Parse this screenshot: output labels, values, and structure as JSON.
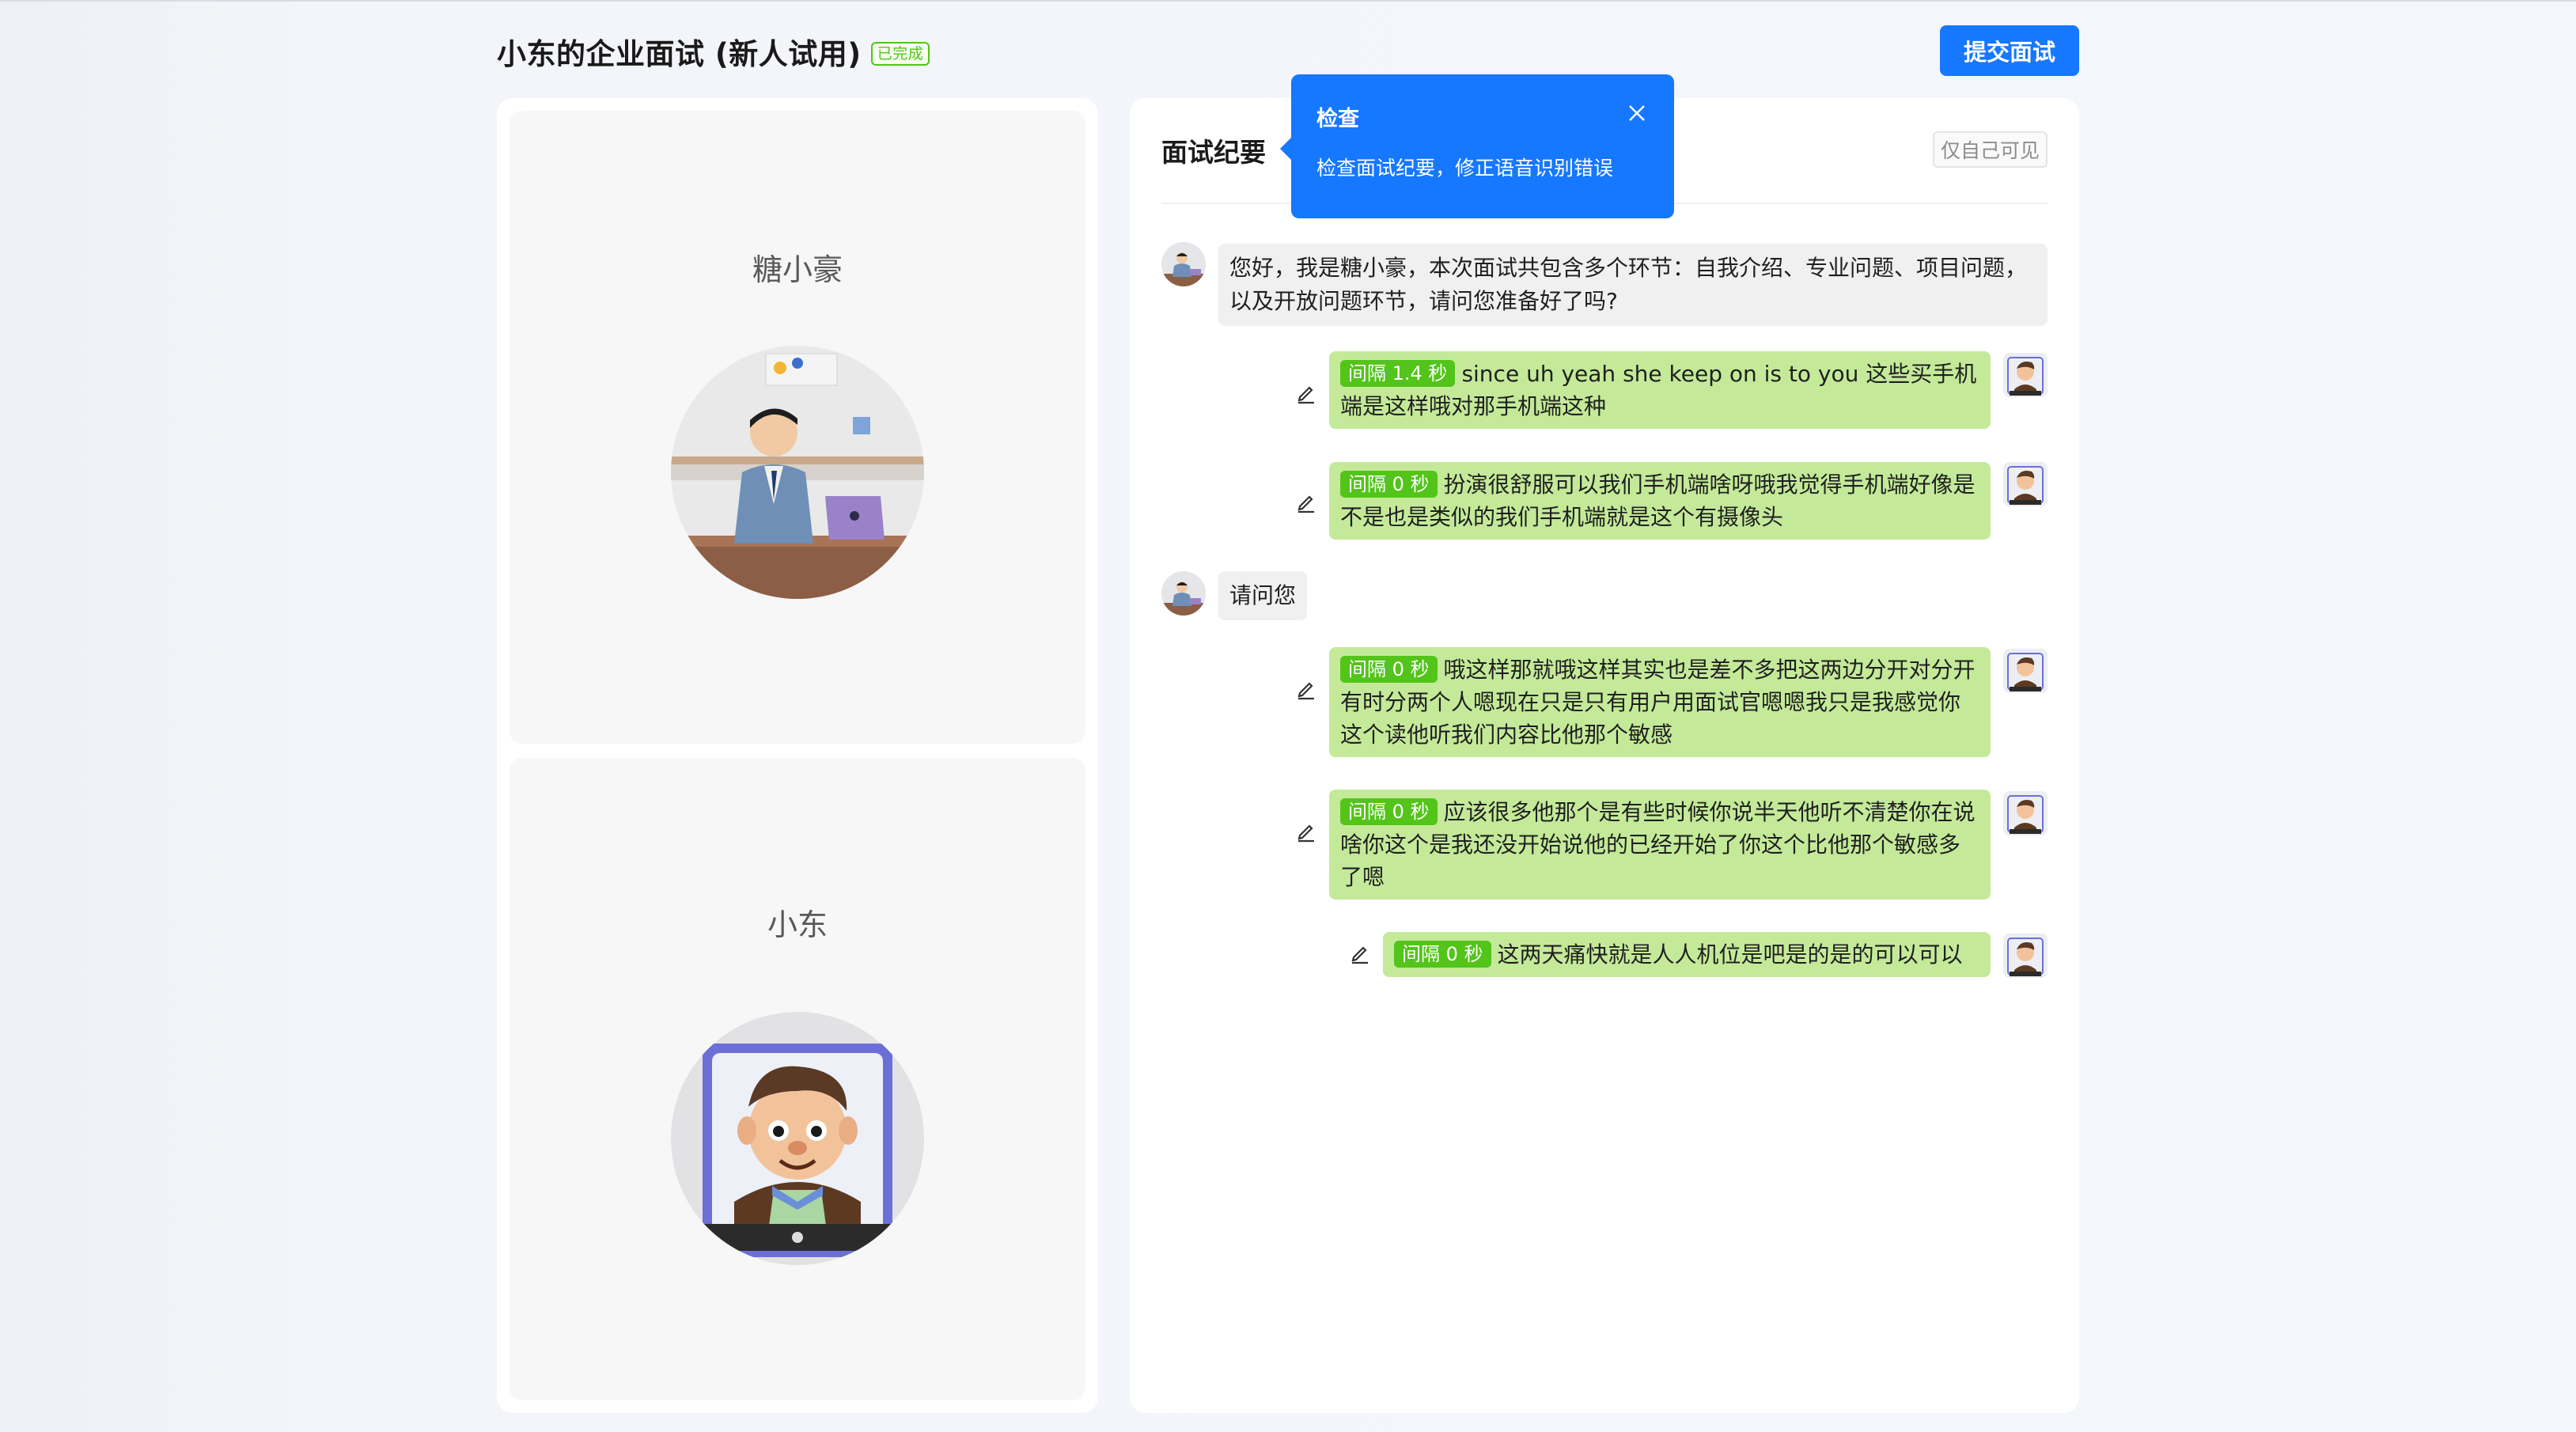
{
  "header": {
    "title": "小东的企业面试 (新人试用)",
    "status": "已完成",
    "submit_label": "提交面试"
  },
  "participants": [
    {
      "name": "糖小豪",
      "role": "interviewer"
    },
    {
      "name": "小东",
      "role": "candidate"
    }
  ],
  "minutes": {
    "title": "面试纪要",
    "visibility": "仅自己可见",
    "messages": [
      {
        "side": "left",
        "text": "您好，我是糖小豪，本次面试共包含多个环节：自我介绍、专业问题、项目问题，以及开放问题环节，请问您准备好了吗?"
      },
      {
        "side": "right",
        "gap": "间隔 1.4 秒",
        "text": "since uh yeah she keep on is to you 这些买手机端是这样哦对那手机端这种"
      },
      {
        "side": "right",
        "gap": "间隔 0 秒",
        "text": "扮演很舒服可以我们手机端啥呀哦我觉得手机端好像是不是也是类似的我们手机端就是这个有摄像头"
      },
      {
        "side": "left",
        "text": "请问您"
      },
      {
        "side": "right",
        "gap": "间隔 0 秒",
        "text": "哦这样那就哦这样其实也是差不多把这两边分开对分开有时分两个人嗯现在只是只有用户用面试官嗯嗯我只是我感觉你这个读他听我们内容比他那个敏感"
      },
      {
        "side": "right",
        "gap": "间隔 0 秒",
        "text": "应该很多他那个是有些时候你说半天他听不清楚你在说啥你这个是我还没开始说他的已经开始了你这个比他那个敏感多了嗯"
      },
      {
        "side": "right",
        "gap": "间隔 0 秒",
        "text": "这两天痛快就是人人机位是吧是的是的可以可以"
      }
    ]
  },
  "tooltip": {
    "title": "检查",
    "text": "检查面试纪要，修正语音识别错误"
  },
  "colors": {
    "primary": "#1677ff",
    "success": "#52c41a",
    "bubble_user": "#c4ea99",
    "bubble_ai": "#f0f0f0"
  },
  "icons": [
    "close-icon",
    "edit-icon",
    "interviewer-avatar",
    "candidate-avatar"
  ]
}
